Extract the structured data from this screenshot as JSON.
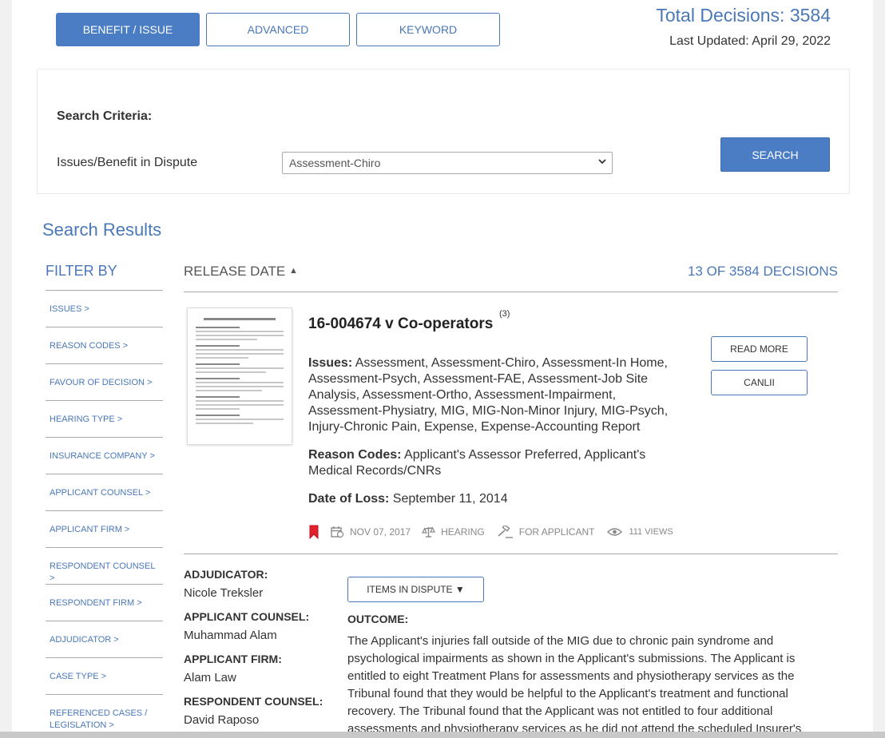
{
  "tabs": [
    {
      "label": "BENEFIT / ISSUE",
      "active": true
    },
    {
      "label": "ADVANCED",
      "active": false
    },
    {
      "label": "KEYWORD",
      "active": false
    }
  ],
  "stats": {
    "total": "Total Decisions: 3584",
    "updated": "Last Updated: April 29, 2022"
  },
  "criteria": {
    "title": "Search Criteria:",
    "issue_label": "Issues/Benefit in Dispute",
    "issue_value": "Assessment-Chiro",
    "search_label": "SEARCH"
  },
  "results": {
    "title": "Search Results",
    "filter_title": "FILTER BY",
    "sort_label": "RELEASE DATE",
    "count": "13 OF 3584 DECISIONS"
  },
  "filters": [
    "ISSUES >",
    "REASON CODES >",
    "FAVOUR OF DECISION >",
    "HEARING TYPE >",
    "INSURANCE COMPANY >",
    "APPLICANT COUNSEL >",
    "APPLICANT FIRM >",
    "RESPONDENT COUNSEL >",
    "RESPONDENT FIRM >",
    "ADJUDICATOR >",
    "CASE TYPE >",
    "REFERENCED CASES / LEGISLATION >"
  ],
  "case": {
    "title": "16-004674 v Co-operators",
    "sup": "(3)",
    "read_more": "READ MORE",
    "canlii": "CANLII",
    "issues_label": "Issues:",
    "issues": "Assessment, Assessment-Chiro, Assessment-In Home, Assessment-Psych, Assessment-FAE, Assessment-Job Site Analysis, Assessment-Ortho, Assessment-Impairment, Assessment-Physiatry, MIG, MIG-Non-Minor Injury, MIG-Psych, Injury-Chronic Pain, Expense, Expense-Accounting Report",
    "reason_label": "Reason Codes:",
    "reasons": "Applicant's Assessor Preferred, Applicant's Medical Records/CNRs",
    "dol_label": "Date of Loss:",
    "dol": "September 11, 2014",
    "meta_date": "NOV 07, 2017",
    "meta_type": "HEARING",
    "meta_favour": "FOR APPLICANT",
    "meta_views": "111 VIEWS",
    "adjudicator_label": "ADJUDICATOR:",
    "adjudicator": "Nicole Treksler",
    "app_counsel_label": "APPLICANT COUNSEL:",
    "app_counsel": "Muhammad Alam",
    "app_firm_label": "APPLICANT FIRM:",
    "app_firm": "Alam Law",
    "resp_counsel_label": "RESPONDENT COUNSEL:",
    "resp_counsel": "David Raposo",
    "items_btn": "ITEMS IN DISPUTE ▼",
    "outcome_label": "OUTCOME:",
    "outcome": "The Applicant's injuries fall outside of the MIG due to chronic pain syndrome and psychological impairments as shown in the Applicant's submissions. The Applicant is entitled to eight Treatment Plans for assessments and physiotherapy services as the Tribunal found that they would be helpful to the Applicant's treatment and functional recovery. The Tribunal found that the Applicant was not entitled to four additional assessments and physiotherapy services as he did not attend the scheduled Insurer's"
  },
  "colors": {
    "accent": "#4a78b8",
    "bookmark": "#e0202a"
  }
}
